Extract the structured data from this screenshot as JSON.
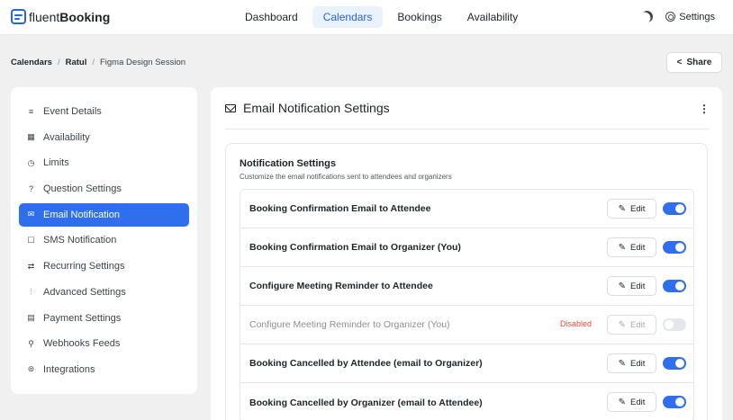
{
  "app": {
    "logo_light": "fluent",
    "logo_bold": "Booking"
  },
  "nav": [
    {
      "label": "Dashboard",
      "active": false
    },
    {
      "label": "Calendars",
      "active": true
    },
    {
      "label": "Bookings",
      "active": false
    },
    {
      "label": "Availability",
      "active": false
    }
  ],
  "topbar": {
    "settings_label": "Settings",
    "theme_icon": "moon-icon",
    "settings_icon": "gear-icon"
  },
  "breadcrumb": {
    "root": "Calendars",
    "owner": "Ratul",
    "event": "Figma Design Session"
  },
  "share_label": "Share",
  "sidebar": {
    "items": [
      {
        "label": "Event Details",
        "icon": "≡",
        "name": "event-details"
      },
      {
        "label": "Availability",
        "icon": "▦",
        "name": "availability"
      },
      {
        "label": "Limits",
        "icon": "◷",
        "name": "limits"
      },
      {
        "label": "Question Settings",
        "icon": "?",
        "name": "question-settings"
      },
      {
        "label": "Email Notification",
        "icon": "✉",
        "name": "email-notification"
      },
      {
        "label": "SMS Notification",
        "icon": "☐",
        "name": "sms-notification"
      },
      {
        "label": "Recurring Settings",
        "icon": "⇄",
        "name": "recurring-settings"
      },
      {
        "label": "Advanced Settings",
        "icon": "⫶",
        "name": "advanced-settings"
      },
      {
        "label": "Payment Settings",
        "icon": "▤",
        "name": "payment-settings"
      },
      {
        "label": "Webhooks Feeds",
        "icon": "⚲",
        "name": "webhooks-feeds"
      },
      {
        "label": "Integrations",
        "icon": "⊜",
        "name": "integrations"
      }
    ],
    "active_index": 4
  },
  "panel": {
    "title": "Email Notification Settings",
    "kebab": "⋮",
    "card_title": "Notification Settings",
    "card_subtitle": "Customize the email notifications sent to attendees and organizers",
    "edit_label": "Edit",
    "disabled_label": "Disabled",
    "rows": [
      {
        "label": "Booking Confirmation Email to Attendee",
        "enabled": true
      },
      {
        "label": "Booking Confirmation Email to Organizer (You)",
        "enabled": true
      },
      {
        "label": "Configure Meeting Reminder to Attendee",
        "enabled": true
      },
      {
        "label": "Configure Meeting Reminder to Organizer (You)",
        "enabled": false
      },
      {
        "label": "Booking Cancelled by Attendee (email to Organizer)",
        "enabled": true
      },
      {
        "label": "Booking Cancelled by Organizer (email to Attendee)",
        "enabled": true
      }
    ]
  },
  "colors": {
    "accent": "#2f6fed",
    "disabled_text": "#e74c3c"
  }
}
